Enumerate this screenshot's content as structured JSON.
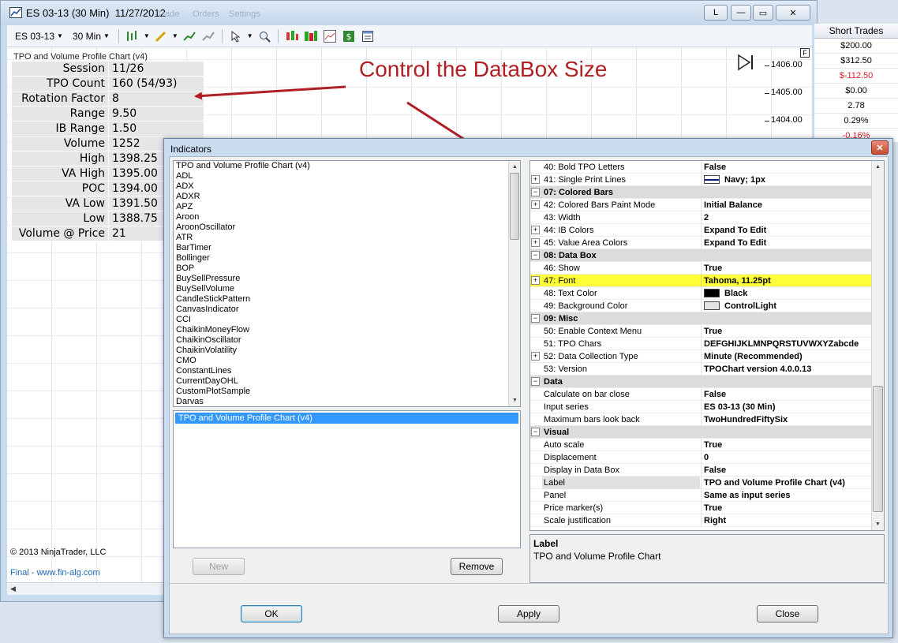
{
  "chart_window": {
    "title": "ES 03-13 (30 Min)  11/27/2012",
    "ghost_menus": [
      "Trade",
      "Orders",
      "Settings"
    ],
    "buttons": {
      "link": "L",
      "minimize": "—",
      "maximize": "▭",
      "close": "✕"
    },
    "toolbar": {
      "instrument": "ES 03-13",
      "interval": "30 Min",
      "icons": [
        "bar-type-icon",
        "drawing-pencil-icon",
        "add-indicator-icon",
        "strategy-icon",
        "select-cursor-icon",
        "zoom-icon",
        "chart-trader-icon",
        "data-series-icon",
        "performance-icon",
        "dollar-icon",
        "properties-icon"
      ]
    },
    "indicator_label": "TPO and Volume Profile Chart (v4)",
    "databox": [
      {
        "key": "Session",
        "value": "11/26"
      },
      {
        "key": "TPO Count",
        "value": "160 (54/93)"
      },
      {
        "key": "Rotation Factor",
        "value": "8"
      },
      {
        "key": "Range",
        "value": "9.50"
      },
      {
        "key": "IB Range",
        "value": "1.50"
      },
      {
        "key": "Volume",
        "value": "1252"
      },
      {
        "key": "High",
        "value": "1398.25"
      },
      {
        "key": "VA High",
        "value": "1395.00"
      },
      {
        "key": "POC",
        "value": "1394.00"
      },
      {
        "key": "VA Low",
        "value": "1391.50"
      },
      {
        "key": "Low",
        "value": "1388.75"
      },
      {
        "key": "Volume @ Price",
        "value": "21"
      }
    ],
    "price_axis": {
      "labels": [
        "1406.00",
        "1405.00",
        "1404.00"
      ],
      "f_button": "F"
    },
    "copyright": "© 2013 NinjaTrader, LLC",
    "footer_link": "Final - www.fin-alg.com"
  },
  "stats_panel": {
    "header": "Short Trades",
    "rows": [
      {
        "value": "$200.00",
        "color": "#000000"
      },
      {
        "value": "$312.50",
        "color": "#000000"
      },
      {
        "value": "$-112.50",
        "color": "#d8202a"
      },
      {
        "value": "$0.00",
        "color": "#000000"
      },
      {
        "value": "2.78",
        "color": "#000000"
      },
      {
        "value": "0.29%",
        "color": "#000000"
      },
      {
        "value": "-0.16%",
        "color": "#d8202a"
      }
    ]
  },
  "annotation": {
    "text": "Control the DataBox Size",
    "color": "#b01f24"
  },
  "dialog": {
    "title": "Indicators",
    "available_indicators": [
      "TPO and Volume Profile Chart (v4)",
      "ADL",
      "ADX",
      "ADXR",
      "APZ",
      "Aroon",
      "AroonOscillator",
      "ATR",
      "BarTimer",
      "Bollinger",
      "BOP",
      "BuySellPressure",
      "BuySellVolume",
      "CandleStickPattern",
      "CanvasIndicator",
      "CCI",
      "ChaikinMoneyFlow",
      "ChaikinOscillator",
      "ChaikinVolatility",
      "CMO",
      "ConstantLines",
      "CurrentDayOHL",
      "CustomPlotSample",
      "Darvas"
    ],
    "applied_indicator": "TPO and Volume Profile Chart (v4)",
    "new_button": "New",
    "remove_button": "Remove",
    "properties": [
      {
        "type": "prop",
        "key": "40: Bold TPO Letters",
        "value": "False"
      },
      {
        "type": "prop",
        "key": "41: Single Print Lines",
        "value": "Navy; 1px",
        "expand": true,
        "swatch": "navy-line"
      },
      {
        "type": "cat",
        "key": "07: Colored Bars"
      },
      {
        "type": "prop",
        "key": "42: Colored Bars Paint Mode",
        "value": "Initial Balance",
        "expand": true
      },
      {
        "type": "prop",
        "key": "43: Width",
        "value": "2"
      },
      {
        "type": "prop",
        "key": "44: IB Colors",
        "value": "Expand To Edit",
        "expand": true
      },
      {
        "type": "prop",
        "key": "45: Value Area Colors",
        "value": "Expand To Edit",
        "expand": true
      },
      {
        "type": "cat",
        "key": "08: Data Box"
      },
      {
        "type": "prop",
        "key": "46: Show",
        "value": "True"
      },
      {
        "type": "prop",
        "key": "47: Font",
        "value": "Tahoma, 11.25pt",
        "expand": true,
        "highlight": true
      },
      {
        "type": "prop",
        "key": "48: Text Color",
        "value": "Black",
        "swatch": "#000000"
      },
      {
        "type": "prop",
        "key": "49: Background Color",
        "value": "ControlLight",
        "swatch": "#e3e3e3"
      },
      {
        "type": "cat",
        "key": "09: Misc"
      },
      {
        "type": "prop",
        "key": "50: Enable Context Menu",
        "value": "True"
      },
      {
        "type": "prop",
        "key": "51: TPO Chars",
        "value": "DEFGHIJKLMNPQRSTUVWXYZabcde"
      },
      {
        "type": "prop",
        "key": "52: Data Collection Type",
        "value": "Minute (Recommended)",
        "expand": true
      },
      {
        "type": "prop",
        "key": "53: Version",
        "value": "TPOChart version 4.0.0.13"
      },
      {
        "type": "cat",
        "key": "Data"
      },
      {
        "type": "prop",
        "key": "Calculate on bar close",
        "value": "False"
      },
      {
        "type": "prop",
        "key": "Input series",
        "value": "ES 03-13 (30 Min)"
      },
      {
        "type": "prop",
        "key": "Maximum bars look back",
        "value": "TwoHundredFiftySix"
      },
      {
        "type": "cat",
        "key": "Visual"
      },
      {
        "type": "prop",
        "key": "Auto scale",
        "value": "True"
      },
      {
        "type": "prop",
        "key": "Displacement",
        "value": "0"
      },
      {
        "type": "prop",
        "key": "Display in Data Box",
        "value": "False"
      },
      {
        "type": "prop",
        "key": "Label",
        "value": "TPO and Volume Profile Chart (v4)",
        "selected": true
      },
      {
        "type": "prop",
        "key": "Panel",
        "value": "Same as input series"
      },
      {
        "type": "prop",
        "key": "Price marker(s)",
        "value": "True"
      },
      {
        "type": "prop",
        "key": "Scale justification",
        "value": "Right"
      }
    ],
    "description": {
      "title": "Label",
      "text": "TPO and Volume Profile Chart"
    },
    "ok_button": "OK",
    "apply_button": "Apply",
    "close_button": "Close"
  }
}
